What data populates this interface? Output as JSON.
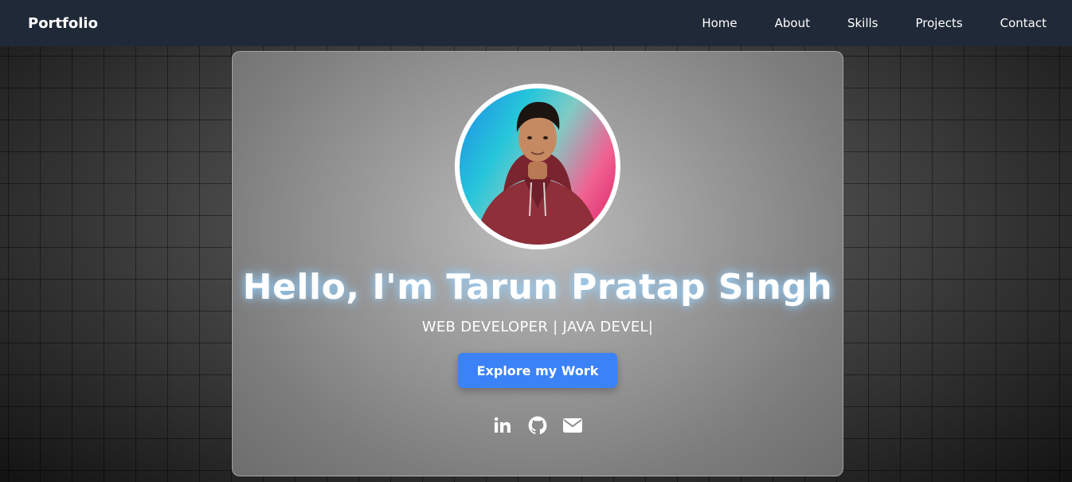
{
  "nav": {
    "brand": "Portfolio",
    "links": [
      "Home",
      "About",
      "Skills",
      "Projects",
      "Contact"
    ]
  },
  "hero": {
    "greeting": "Hello, I'm Tarun Pratap Singh",
    "subtitle": "WEB DEVELOPER | JAVA DEVEL|",
    "cta_label": "Explore my Work",
    "socials": [
      "linkedin-icon",
      "github-icon",
      "mail-icon"
    ]
  },
  "colors": {
    "navbar": "#1f2937",
    "accent": "#3b82f6",
    "glow": "#96d2ff"
  }
}
